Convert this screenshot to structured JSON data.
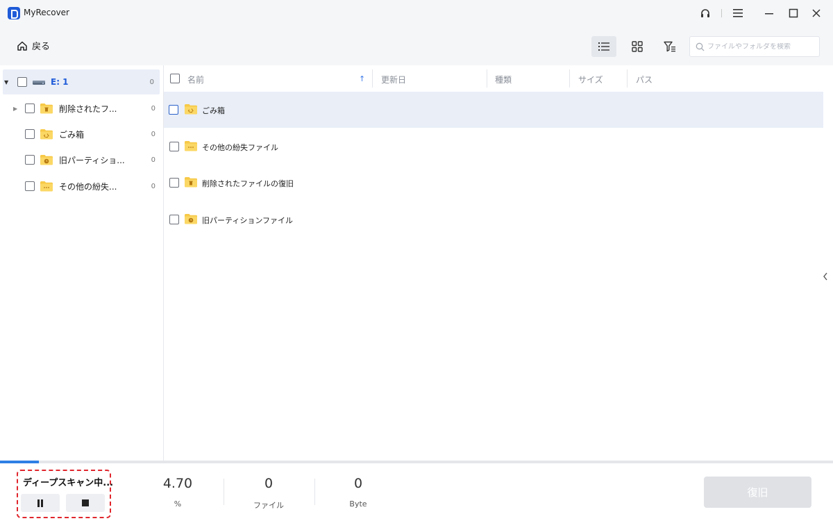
{
  "app": {
    "title": "MyRecover"
  },
  "toolbar": {
    "back_label": "戻る",
    "search_placeholder": "ファイルやフォルダを検索"
  },
  "tree": {
    "items": [
      {
        "label": "E: 1",
        "count": "0"
      },
      {
        "label": "削除されたフ...",
        "count": "0"
      },
      {
        "label": "ごみ箱",
        "count": "0"
      },
      {
        "label": "旧パーティショ...",
        "count": "0"
      },
      {
        "label": "その他の紛失...",
        "count": "0"
      }
    ]
  },
  "list": {
    "columns": [
      "名前",
      "更新日",
      "種類",
      "サイズ",
      "パス"
    ],
    "sort_indicator": "↑",
    "rows": [
      {
        "name": "ごみ箱"
      },
      {
        "name": "その他の紛失ファイル"
      },
      {
        "name": "削除されたファイルの復旧"
      },
      {
        "name": "旧パーティションファイル"
      }
    ]
  },
  "scan": {
    "status": "ディープスキャン中...",
    "progress_percent": 4.7,
    "stats": [
      {
        "value": "4.70",
        "unit": "%"
      },
      {
        "value": "0",
        "unit": "ファイル"
      },
      {
        "value": "0",
        "unit": "Byte"
      }
    ]
  },
  "actions": {
    "restore_label": "復旧"
  },
  "colors": {
    "accent": "#1f5bd8",
    "progress": "#2f7fe4",
    "folder": "#f7c948",
    "selected_row": "#e9eef7",
    "highlight_border": "#e0262d"
  }
}
